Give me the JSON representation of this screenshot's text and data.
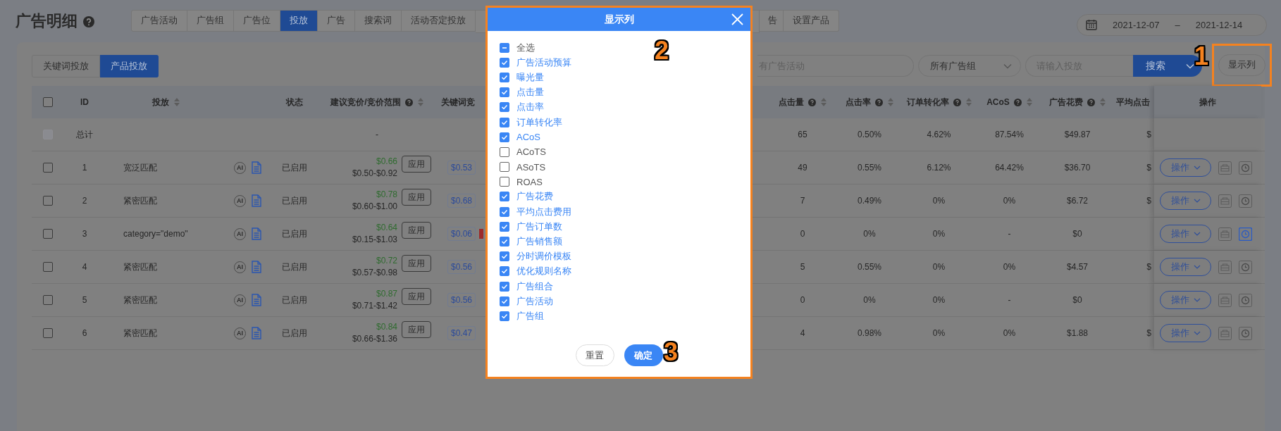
{
  "page": {
    "title": "广告明细"
  },
  "tabs": [
    {
      "label": "广告活动",
      "selected": false
    },
    {
      "label": "广告组",
      "selected": false
    },
    {
      "label": "广告位",
      "selected": false
    },
    {
      "label": "投放",
      "selected": true
    },
    {
      "label": "广告",
      "selected": false
    },
    {
      "label": "搜索词",
      "selected": false
    },
    {
      "label": "活动否定投放",
      "selected": false
    },
    {
      "label": "告",
      "selected": false
    },
    {
      "label": "设置产品",
      "selected": false
    }
  ],
  "date_range": {
    "start": "2021-12-07",
    "separator": "–",
    "end": "2021-12-14"
  },
  "sub_tabs": [
    {
      "label": "关键词投放",
      "selected": false
    },
    {
      "label": "产品投放",
      "selected": true
    }
  ],
  "filters": {
    "campaign_placeholder": "有广告活动",
    "ad_group": "所有广告组",
    "targeting_placeholder": "请输入投放",
    "search_button": "搜索",
    "columns_button": "显示列",
    "columns_button_highlighted": true
  },
  "table": {
    "left_columns": [
      {
        "label": "ID",
        "help": false,
        "sortable": false
      },
      {
        "label": "投放",
        "help": false,
        "sortable": true
      },
      {
        "label": "状态",
        "help": false,
        "sortable": false
      },
      {
        "label": "建议竞价/竞价范围",
        "help": true,
        "sortable": true
      },
      {
        "label": "关键词竞",
        "help": false,
        "sortable": false
      }
    ],
    "right_columns": [
      {
        "label": "点击量",
        "help": true,
        "sortable": true
      },
      {
        "label": "点击率",
        "help": true,
        "sortable": true
      },
      {
        "label": "订单转化率",
        "help": true,
        "sortable": true
      },
      {
        "label": "ACoS",
        "help": true,
        "sortable": true
      },
      {
        "label": "广告花费",
        "help": true,
        "sortable": true
      },
      {
        "label": "平均点击",
        "help": false,
        "sortable": false
      }
    ],
    "action_column": "操作",
    "header_checked": false,
    "total": {
      "label": "总计",
      "disabled": true,
      "bid_range": "-",
      "metrics": [
        "65",
        "0.50%",
        "4.62%",
        "87.54%",
        "$49.87",
        "$"
      ]
    },
    "rows": [
      {
        "checked": false,
        "id": "1",
        "name": "宽泛匹配",
        "ai_badge": "AI",
        "status": "已启用",
        "suggested_bid": "$0.66",
        "bid_range": "$0.50-$0.92",
        "apply": "应用",
        "keyword_bid": "$0.53",
        "alert": false,
        "metrics": [
          "49",
          "0.55%",
          "6.12%",
          "64.42%",
          "$36.70",
          "$"
        ],
        "action": "操作",
        "schedule_on": false
      },
      {
        "checked": false,
        "id": "2",
        "name": "紧密匹配",
        "ai_badge": "AI",
        "status": "已启用",
        "suggested_bid": "$0.78",
        "bid_range": "$0.60-$1.00",
        "apply": "应用",
        "keyword_bid": "$0.68",
        "alert": false,
        "metrics": [
          "7",
          "0.49%",
          "0%",
          "0%",
          "$6.72",
          "$"
        ],
        "action": "操作",
        "schedule_on": false
      },
      {
        "checked": false,
        "id": "3",
        "name": "category=\"demo\"",
        "ai_badge": "AI",
        "status": "已启用",
        "suggested_bid": "$0.64",
        "bid_range": "$0.15-$1.03",
        "apply": "应用",
        "keyword_bid": "$0.06",
        "alert": true,
        "metrics": [
          "0",
          "0%",
          "0%",
          "-",
          "$0"
        ],
        "action": "操作",
        "schedule_on": true
      },
      {
        "checked": false,
        "id": "4",
        "name": "紧密匹配",
        "ai_badge": "AI",
        "status": "已启用",
        "suggested_bid": "$0.72",
        "bid_range": "$0.57-$0.98",
        "apply": "应用",
        "keyword_bid": "$0.56",
        "alert": false,
        "metrics": [
          "5",
          "0.55%",
          "0%",
          "0%",
          "$4.57",
          "$"
        ],
        "action": "操作",
        "schedule_on": false
      },
      {
        "checked": false,
        "id": "5",
        "name": "紧密匹配",
        "ai_badge": "AI",
        "status": "已启用",
        "suggested_bid": "$0.87",
        "bid_range": "$0.71-$1.42",
        "apply": "应用",
        "keyword_bid": "$0.56",
        "alert": false,
        "metrics": [
          "0",
          "0%",
          "0%",
          "-",
          "$0"
        ],
        "action": "操作",
        "schedule_on": false
      },
      {
        "checked": false,
        "id": "6",
        "name": "紧密匹配",
        "ai_badge": "AI",
        "status": "已启用",
        "suggested_bid": "$0.84",
        "bid_range": "$0.66-$1.36",
        "apply": "应用",
        "keyword_bid": "$0.47",
        "alert": false,
        "metrics": [
          "4",
          "0.98%",
          "0%",
          "0%",
          "$1.88",
          "$"
        ],
        "action": "操作",
        "schedule_on": false
      }
    ]
  },
  "modal": {
    "title": "显示列",
    "highlighted": true,
    "select_all": {
      "label": "全选",
      "indeterminate": true
    },
    "items": [
      {
        "label": "广告活动预算",
        "checked": true
      },
      {
        "label": "曝光量",
        "checked": true
      },
      {
        "label": "点击量",
        "checked": true
      },
      {
        "label": "点击率",
        "checked": true
      },
      {
        "label": "订单转化率",
        "checked": true
      },
      {
        "label": "ACoS",
        "checked": true
      },
      {
        "label": "ACoTS",
        "checked": false
      },
      {
        "label": "ASoTS",
        "checked": false
      },
      {
        "label": "ROAS",
        "checked": false
      },
      {
        "label": "广告花费",
        "checked": true
      },
      {
        "label": "平均点击费用",
        "checked": true
      },
      {
        "label": "广告订单数",
        "checked": true
      },
      {
        "label": "广告销售额",
        "checked": true
      },
      {
        "label": "分时调价模板",
        "checked": true
      },
      {
        "label": "优化规则名称",
        "checked": true
      },
      {
        "label": "广告组合",
        "checked": true
      },
      {
        "label": "广告活动",
        "checked": true
      },
      {
        "label": "广告组",
        "checked": true
      }
    ],
    "reset_button": "重置",
    "confirm_button": "确定"
  },
  "callouts": [
    {
      "number": "1"
    },
    {
      "number": "2"
    },
    {
      "number": "3"
    }
  ]
}
